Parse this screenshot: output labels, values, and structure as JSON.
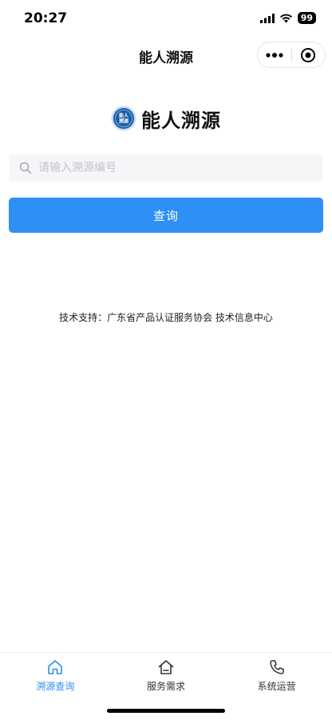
{
  "status_bar": {
    "time": "20:27",
    "battery": "99"
  },
  "nav": {
    "title": "能人溯源"
  },
  "brand": {
    "title": "能人溯源",
    "logo_text_top": "能人",
    "logo_text_bottom": "溯源"
  },
  "search": {
    "placeholder": "请输入溯源编号",
    "value": ""
  },
  "query_button": {
    "label": "查询"
  },
  "footer": {
    "support_text": "技术支持：广东省产品认证服务协会 技术信息中心"
  },
  "tabs": [
    {
      "label": "溯源查询",
      "icon": "home-icon",
      "active": true
    },
    {
      "label": "服务需求",
      "icon": "house-outline-icon",
      "active": false
    },
    {
      "label": "系统运营",
      "icon": "phone-icon",
      "active": false
    }
  ],
  "colors": {
    "accent": "#2e8ff4",
    "search_bg": "#f5f6f8",
    "logo_blue": "#1e5ca8"
  }
}
